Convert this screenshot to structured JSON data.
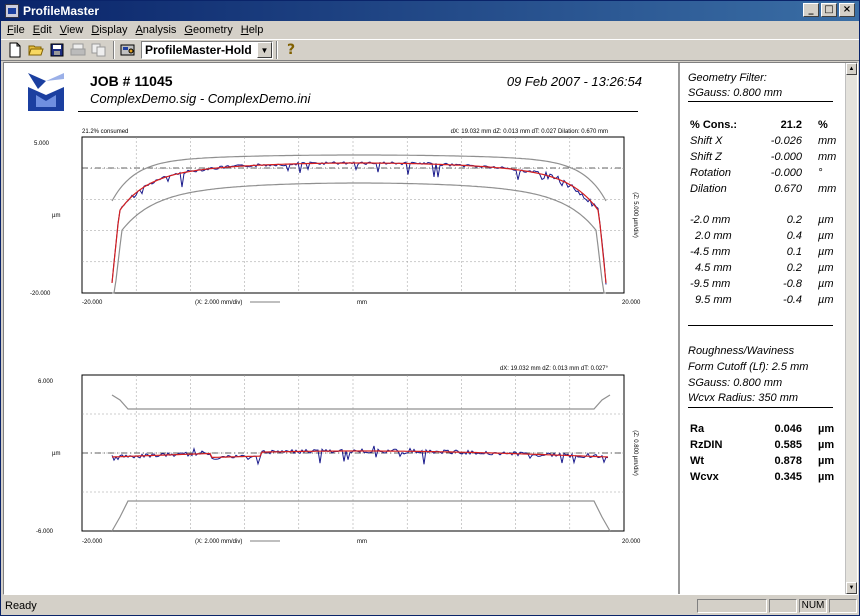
{
  "window": {
    "title": "ProfileMaster",
    "buttons": [
      "_",
      "□",
      "×"
    ]
  },
  "menu": [
    {
      "label": "File",
      "key": "F",
      "rest": "ile"
    },
    {
      "label": "Edit",
      "key": "E",
      "rest": "dit"
    },
    {
      "label": "View",
      "key": "V",
      "rest": "iew"
    },
    {
      "label": "Display",
      "key": "D",
      "rest": "isplay"
    },
    {
      "label": "Analysis",
      "key": "A",
      "rest": "nalysis"
    },
    {
      "label": "Geometry",
      "key": "G",
      "rest": "eometry"
    },
    {
      "label": "Help",
      "key": "H",
      "rest": "elp"
    }
  ],
  "toolbar": {
    "icons": [
      "new-file-icon",
      "open-folder-icon",
      "save-icon",
      "print-icon",
      "copy-icon",
      "settings-icon",
      "help-icon"
    ],
    "combo_value": "ProfileMaster-Hold",
    "help_glyph": "?"
  },
  "report": {
    "job": "JOB # 11045",
    "files": "ComplexDemo.sig  -  ComplexDemo.ini",
    "date": "09 Feb 2007 - 13:26:54"
  },
  "plot1": {
    "consumed": "21.2% consumed",
    "stats": "dX: 19.032 mm    dZ: 0.013 mm    dT: 0.027    Dilation: 0.670 mm",
    "y_top": "5.000",
    "y_mid": "µm",
    "y_bottom": "-20.000",
    "x_left": "-20.000",
    "x_mid": "mm",
    "x_right": "20.000",
    "x_scale": "(X: 2.000 mm/div)",
    "y_scale": "(Z: 5.000 µm/div)"
  },
  "plot2": {
    "stats": "dX: 19.032 mm    dZ: 0.013 mm    dT: 0.027°",
    "y_top": "6.000",
    "y_mid": "µm",
    "y_bottom": "-6.000",
    "x_left": "-20.000",
    "x_mid": "mm",
    "x_right": "20.000",
    "x_scale": "(X: 2.000 mm/div)",
    "y_scale": "(Z: 0.800 µm/div)"
  },
  "panel": {
    "geometry_filter": "Geometry Filter:",
    "sgauss1": "SGauss: 0.800 mm",
    "cons_label": "% Cons.:",
    "cons_value": "21.2",
    "cons_unit": "%",
    "rows": [
      {
        "label": "Shift X",
        "value": "-0.026",
        "unit": "mm"
      },
      {
        "label": "Shift Z",
        "value": "-0.000",
        "unit": "mm"
      },
      {
        "label": "Rotation",
        "value": "-0.000",
        "unit": "°"
      },
      {
        "label": "Dilation",
        "value": "0.670",
        "unit": "mm"
      }
    ],
    "points": [
      {
        "label": "-2.0 mm",
        "value": "0.2",
        "unit": "µm"
      },
      {
        "label": "2.0 mm",
        "value": "0.4",
        "unit": "µm"
      },
      {
        "label": "-4.5 mm",
        "value": "0.1",
        "unit": "µm"
      },
      {
        "label": "4.5 mm",
        "value": "0.2",
        "unit": "µm"
      },
      {
        "label": "-9.5 mm",
        "value": "-0.8",
        "unit": "µm"
      },
      {
        "label": "9.5 mm",
        "value": "-0.4",
        "unit": "µm"
      }
    ],
    "rw_title": "Roughness/Waviness",
    "form_cutoff": "Form Cutoff (Lf): 2.5 mm",
    "sgauss2": "SGauss: 0.800 mm",
    "wcvx_radius": "Wcvx Radius: 350 mm",
    "params": [
      {
        "label": "Ra",
        "value": "0.046",
        "unit": "µm"
      },
      {
        "label": "RzDIN",
        "value": "0.585",
        "unit": "µm"
      },
      {
        "label": "Wt",
        "value": "0.878",
        "unit": "µm"
      },
      {
        "label": "Wcvx",
        "value": "0.345",
        "unit": "µm"
      }
    ]
  },
  "status": {
    "text": "Ready",
    "cells": [
      "",
      "",
      "NUM",
      ""
    ]
  },
  "colors": {
    "title_start": "#0a246a",
    "title_end": "#3a6ea5",
    "measured": "#1a1a8c",
    "fit": "#d42020",
    "tolerance": "#909090"
  }
}
